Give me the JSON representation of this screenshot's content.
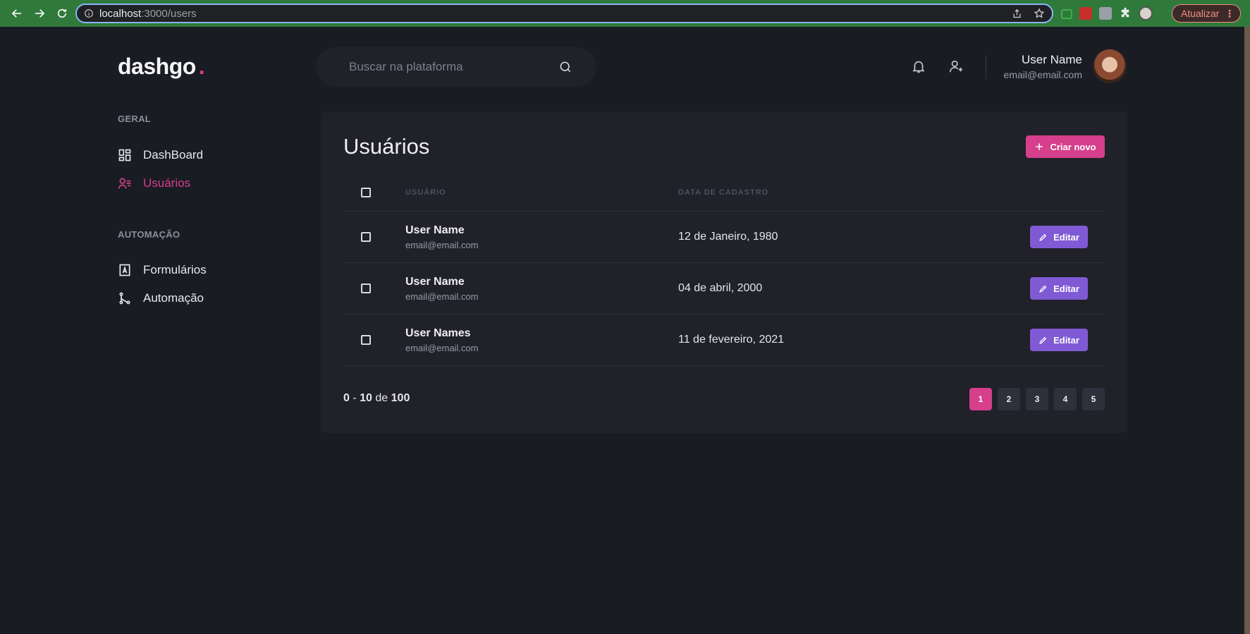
{
  "browser": {
    "url_host": "localhost",
    "url_path": ":3000/users",
    "update_label": "Atualizar"
  },
  "app": {
    "logo": "dashgo",
    "logo_dot": ".",
    "search_placeholder": "Buscar na plataforma",
    "profile": {
      "name": "User Name",
      "email": "email@email.com"
    }
  },
  "sidebar": {
    "sections": [
      {
        "title": "GERAL",
        "items": [
          {
            "label": "DashBoard",
            "icon": "dashboard-icon"
          },
          {
            "label": "Usuários",
            "icon": "users-icon",
            "active": true
          }
        ]
      },
      {
        "title": "AUTOMAÇÃO",
        "items": [
          {
            "label": "Formulários",
            "icon": "form-icon"
          },
          {
            "label": "Automação",
            "icon": "automation-icon"
          }
        ]
      }
    ]
  },
  "main": {
    "title": "Usuários",
    "create_label": "Criar novo",
    "table": {
      "headers": {
        "user": "USUÁRIO",
        "date": "DATA DE CADASTRO"
      },
      "rows": [
        {
          "name": "User Name",
          "email": "email@email.com",
          "date": "12 de Janeiro, 1980",
          "action": "Editar"
        },
        {
          "name": "User Name",
          "email": "email@email.com",
          "date": "04 de abril, 2000",
          "action": "Editar"
        },
        {
          "name": "User Names",
          "email": "email@email.com",
          "date": "11 de fevereiro, 2021",
          "action": "Editar"
        }
      ]
    },
    "pagination": {
      "start": "0",
      "sep": "-",
      "end": "10",
      "of": "de",
      "total": "100",
      "pages": [
        "1",
        "2",
        "3",
        "4",
        "5"
      ],
      "current": "1"
    }
  },
  "colors": {
    "accent": "#d53f8c",
    "edit": "#805ad5",
    "background": "#1a1c23",
    "card": "#202129"
  }
}
